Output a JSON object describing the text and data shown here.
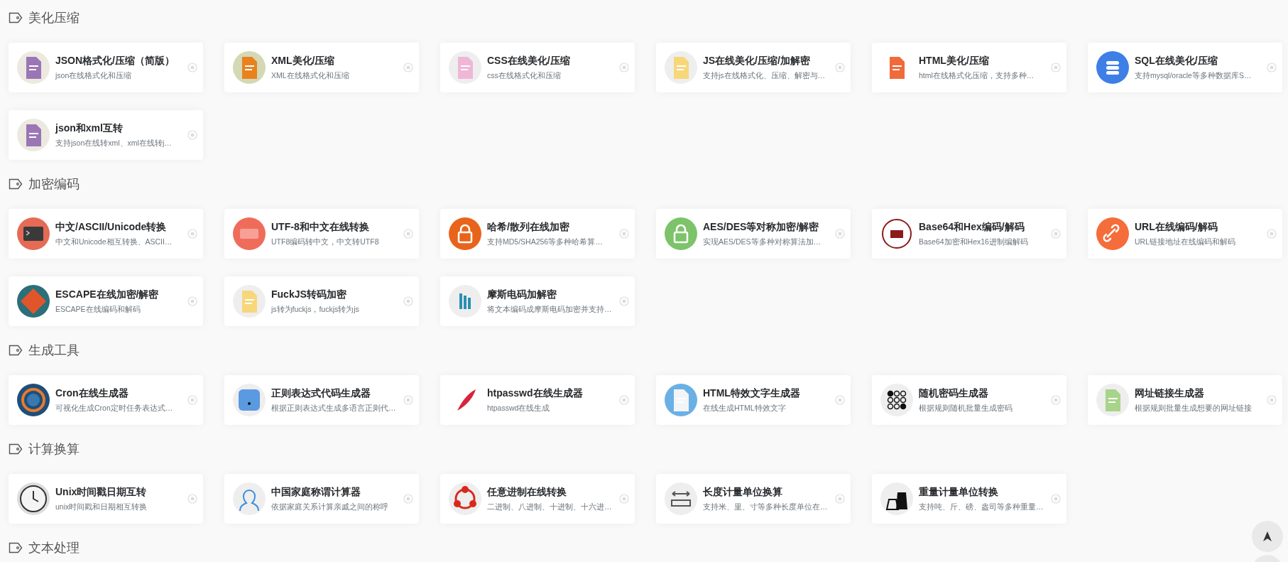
{
  "sections": [
    {
      "title": "美化压缩",
      "tools": [
        {
          "title": "JSON格式化/压缩（简版）",
          "desc": "json在线格式化和压缩"
        },
        {
          "title": "XML美化/压缩",
          "desc": "XML在线格式化和压缩"
        },
        {
          "title": "CSS在线美化/压缩",
          "desc": "css在线格式化和压缩"
        },
        {
          "title": "JS在线美化/压缩/加解密",
          "desc": "支持js在线格式化、压缩、解密与…"
        },
        {
          "title": "HTML美化/压缩",
          "desc": "html在线格式化压缩，支持多种…"
        },
        {
          "title": "SQL在线美化/压缩",
          "desc": "支持mysql/oracle等多种数据库S…"
        },
        {
          "title": "json和xml互转",
          "desc": "支持json在线转xml、xml在线转j…"
        }
      ]
    },
    {
      "title": "加密编码",
      "tools": [
        {
          "title": "中文/ASCII/Unicode转换",
          "desc": "中文和Unicode相互转换、ASCII…"
        },
        {
          "title": "UTF-8和中文在线转换",
          "desc": "UTF8编码转中文，中文转UTF8"
        },
        {
          "title": "哈希/散列在线加密",
          "desc": "支持MD5/SHA256等多种哈希算…"
        },
        {
          "title": "AES/DES等对称加密/解密",
          "desc": "实现AES/DES等多种对称算法加…"
        },
        {
          "title": "Base64和Hex编码/解码",
          "desc": "Base64加密和Hex16进制编解码"
        },
        {
          "title": "URL在线编码/解码",
          "desc": "URL链接地址在线编码和解码"
        },
        {
          "title": "ESCAPE在线加密/解密",
          "desc": "ESCAPE在线编码和解码"
        },
        {
          "title": "FuckJS转码加密",
          "desc": "js转为fuckjs，fuckjs转为js"
        },
        {
          "title": "摩斯电码加解密",
          "desc": "将文本编码成摩斯电码加密并支持…"
        }
      ]
    },
    {
      "title": "生成工具",
      "tools": [
        {
          "title": "Cron在线生成器",
          "desc": "可视化生成Cron定时任务表达式…"
        },
        {
          "title": "正则表达式代码生成器",
          "desc": "根据正则表达式生成多语言正则代…"
        },
        {
          "title": "htpasswd在线生成器",
          "desc": "htpasswd在线生成"
        },
        {
          "title": "HTML特效文字生成器",
          "desc": "在线生成HTML特效文字"
        },
        {
          "title": "随机密码生成器",
          "desc": "根据规则随机批量生成密码"
        },
        {
          "title": "网址链接生成器",
          "desc": "根据规则批量生成想要的网址链接"
        }
      ]
    },
    {
      "title": "计算换算",
      "tools": [
        {
          "title": "Unix时间戳日期互转",
          "desc": "unix时间戳和日期相互转换"
        },
        {
          "title": "中国家庭称谓计算器",
          "desc": "依据家庭关系计算亲戚之间的称呼"
        },
        {
          "title": "任意进制在线转换",
          "desc": "二进制、八进制、十进制、十六进…"
        },
        {
          "title": "长度计量单位换算",
          "desc": "支持米、里、寸等多种长度单位在…"
        },
        {
          "title": "重量计量单位转换",
          "desc": "支持吨、斤、磅、盎司等多种重量…"
        }
      ]
    },
    {
      "title": "文本处理"
    }
  ]
}
